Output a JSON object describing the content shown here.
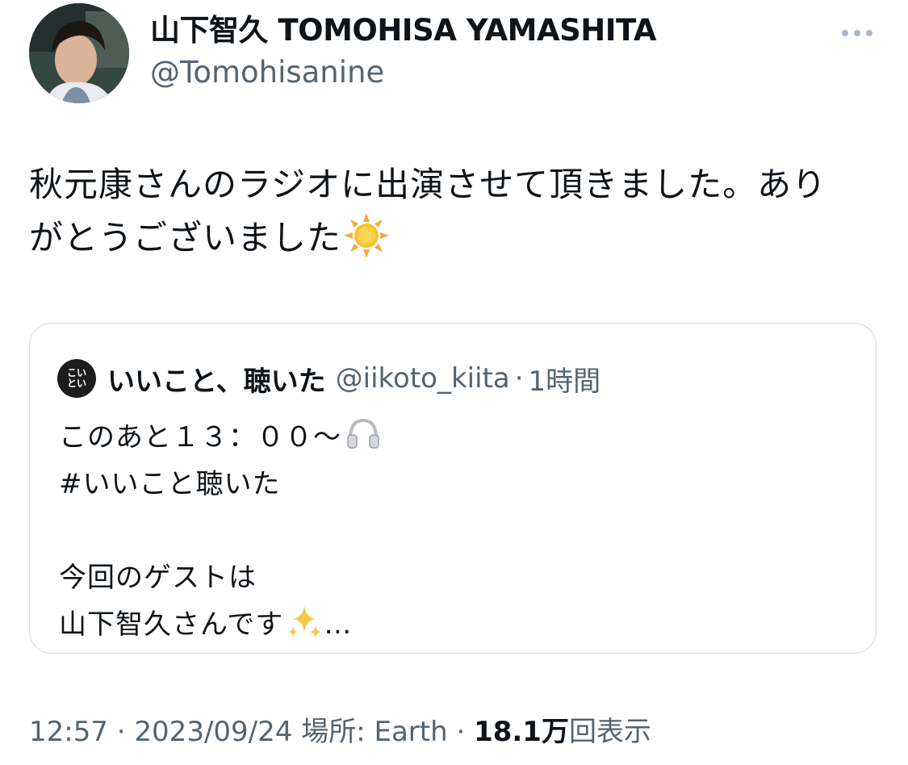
{
  "author": {
    "display_name": "山下智久 TOMOHISA YAMASHITA",
    "handle": "@Tomohisanine"
  },
  "tweet": {
    "text_line1": "秋元康さんのラジオに出演させて頂きました。あり",
    "text_line2": "がとうございました",
    "emoji": "sun-emoji"
  },
  "quoted_tweet": {
    "avatar_text": "こい\nとい",
    "name": "いいこと、聴いた",
    "handle": "@iikoto_kiita",
    "separator": "·",
    "time": "1時間",
    "lines": [
      "このあと１３：００～",
      "#いいこと聴いた",
      "",
      "今回のゲストは",
      "山下智久さんです"
    ],
    "ellipsis": "…",
    "line1_emoji": "headphones-emoji",
    "line5_emoji": "sparkles-emoji"
  },
  "meta": {
    "time": "12:57",
    "sep1": " · ",
    "date": "2023/09/24",
    "location_label": " 場所: Earth",
    "sep2": " · ",
    "views_count": "18.1万",
    "views_label": "回表示"
  },
  "colors": {
    "text_primary": "#0f1419",
    "text_secondary": "#536471",
    "border": "#cfd9de"
  }
}
